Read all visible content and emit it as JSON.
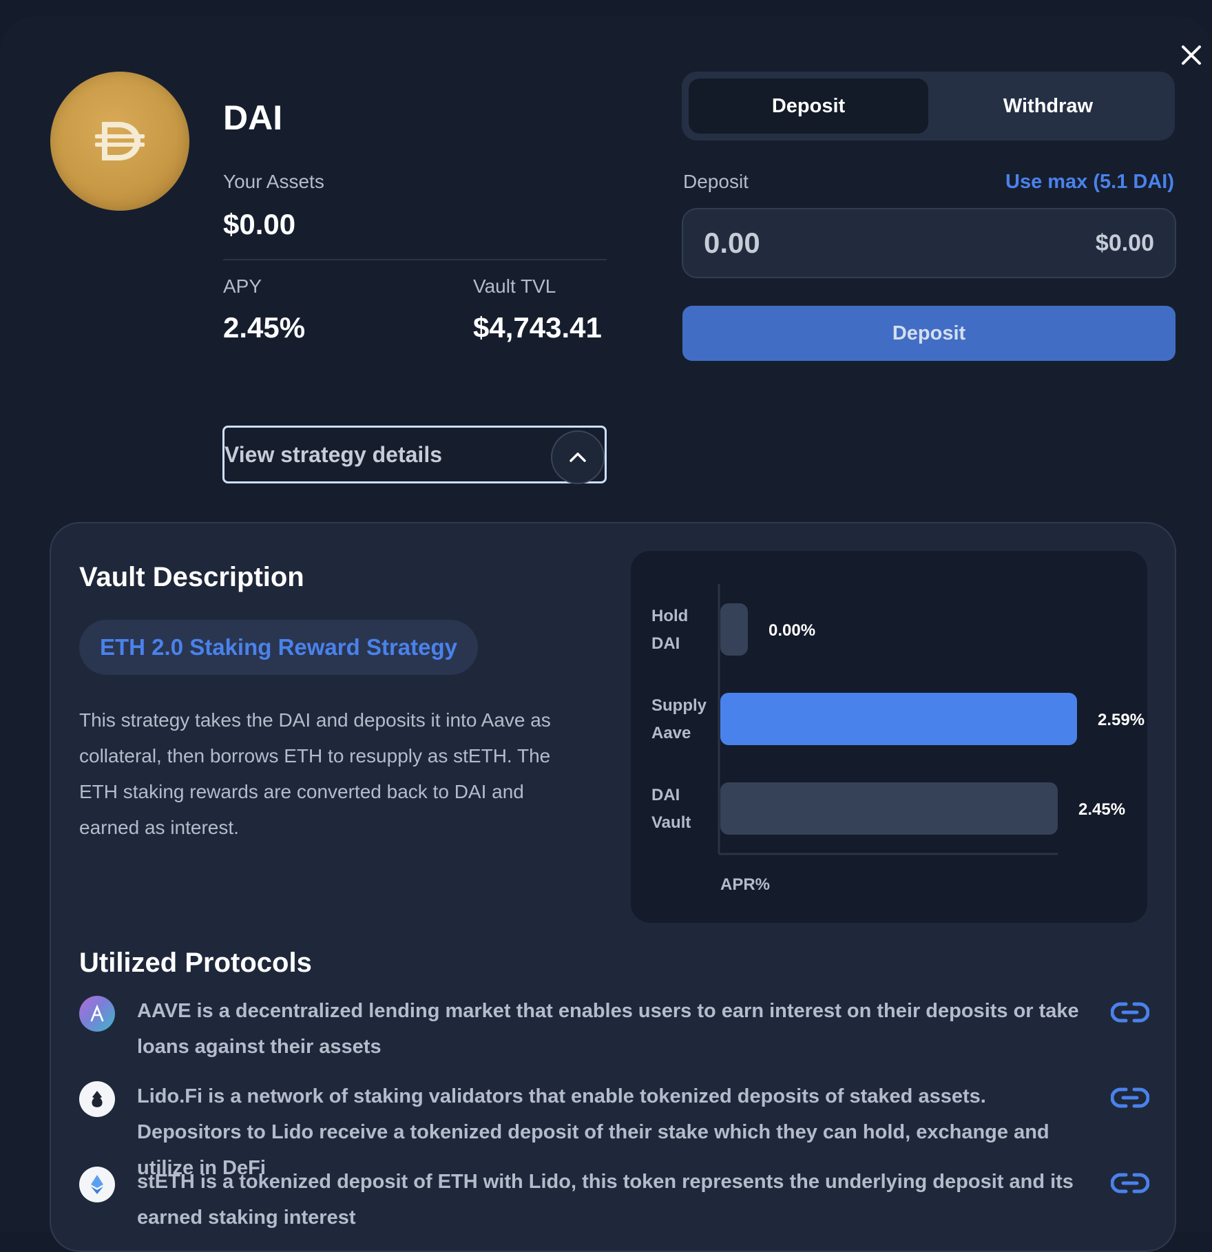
{
  "asset": {
    "name": "DAI",
    "your_assets_label": "Your Assets",
    "your_assets_value": "$0.00",
    "apy_label": "APY",
    "apy_value": "2.45%",
    "tvl_label": "Vault TVL",
    "tvl_value": "$4,743.41"
  },
  "tabs": [
    "Deposit",
    "Withdraw"
  ],
  "active_tab": "Deposit",
  "deposit": {
    "label": "Deposit",
    "use_max": "Use max (5.1 DAI)",
    "input_placeholder": "0.00",
    "usd_value": "$0.00",
    "button": "Deposit"
  },
  "strategy_toggle": "View strategy details",
  "vault_description": {
    "title": "Vault Description",
    "strategy_name": "ETH 2.0 Staking Reward Strategy",
    "text": "This strategy takes the DAI and deposits it into Aave as collateral, then borrows ETH to resupply as stETH. The ETH staking rewards are converted back to DAI and earned as interest."
  },
  "chart_data": {
    "type": "bar",
    "orientation": "horizontal",
    "categories": [
      [
        "Hold",
        "DAI"
      ],
      [
        "Supply",
        "Aave"
      ],
      [
        "DAI",
        "Vault"
      ]
    ],
    "values": [
      0.0,
      2.59,
      2.45
    ],
    "value_labels": [
      "0.00%",
      "2.59%",
      "2.45%"
    ],
    "xlabel": "APR%",
    "xlim": [
      0,
      2.7
    ],
    "colors": [
      "#364257",
      "#4a82ec",
      "#364257"
    ]
  },
  "protocols": {
    "title": "Utilized Protocols",
    "items": [
      {
        "name": "AAVE",
        "icon": "aave-icon",
        "text": "AAVE is a decentralized lending market that enables users to earn interest on their deposits or take loans against their assets"
      },
      {
        "name": "Lido.Fi",
        "icon": "lido-icon",
        "text": "Lido.Fi is a network of staking validators that enable tokenized deposits of staked assets. Depositors to Lido receive a tokenized deposit of their stake which they can hold, exchange and utilize in DeFi"
      },
      {
        "name": "stETH",
        "icon": "steth-icon",
        "text": "stETH is a tokenized deposit of ETH with Lido, this token represents the underlying deposit and its earned staking interest"
      }
    ]
  },
  "colors": {
    "accent": "#4a82ec",
    "button": "#416ec4",
    "background": "#161e2e",
    "panel": "#1f283a"
  }
}
